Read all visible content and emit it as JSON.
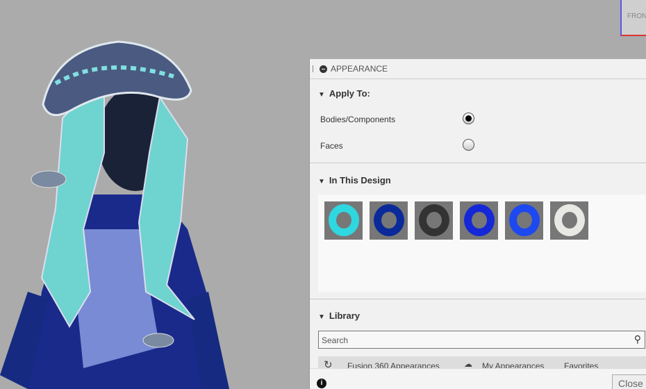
{
  "viewcube": {
    "face": "FRONT"
  },
  "panel": {
    "title": "APPEARANCE",
    "apply_to": {
      "label": "Apply To:",
      "options": [
        {
          "label": "Bodies/Components",
          "selected": true
        },
        {
          "label": "Faces",
          "selected": false
        }
      ]
    },
    "in_design": {
      "label": "In This Design",
      "swatches": [
        {
          "name": "cyan",
          "color": "#2fd8e0"
        },
        {
          "name": "dark-blue",
          "color": "#0a2a9a"
        },
        {
          "name": "gray-black",
          "color": "#333333"
        },
        {
          "name": "blue",
          "color": "#1428d8"
        },
        {
          "name": "bright-blue",
          "color": "#1e48f0"
        },
        {
          "name": "white",
          "color": "#e8e8e4"
        }
      ]
    },
    "library": {
      "label": "Library",
      "search_placeholder": "Search",
      "tabs": [
        "Fusion 360 Appearances",
        "My Appearances",
        "Favorites"
      ]
    },
    "close_label": "Close"
  }
}
